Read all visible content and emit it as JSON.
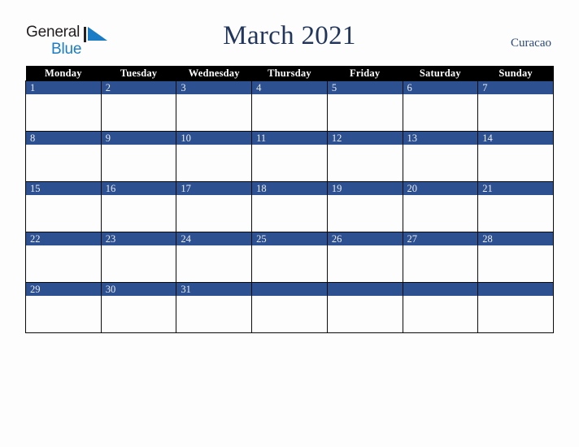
{
  "brand": {
    "name_part1": "General",
    "name_part2": "Blue",
    "mark": "triangle-icon"
  },
  "header": {
    "title": "March 2021",
    "location": "Curacao"
  },
  "calendar": {
    "weekday_headers": [
      "Monday",
      "Tuesday",
      "Wednesday",
      "Thursday",
      "Friday",
      "Saturday",
      "Sunday"
    ],
    "accent_color": "#2d5190",
    "header_color": "#000000",
    "weeks": [
      [
        {
          "date": "1"
        },
        {
          "date": "2"
        },
        {
          "date": "3"
        },
        {
          "date": "4"
        },
        {
          "date": "5"
        },
        {
          "date": "6"
        },
        {
          "date": "7"
        }
      ],
      [
        {
          "date": "8"
        },
        {
          "date": "9"
        },
        {
          "date": "10"
        },
        {
          "date": "11"
        },
        {
          "date": "12"
        },
        {
          "date": "13"
        },
        {
          "date": "14"
        }
      ],
      [
        {
          "date": "15"
        },
        {
          "date": "16"
        },
        {
          "date": "17"
        },
        {
          "date": "18"
        },
        {
          "date": "19"
        },
        {
          "date": "20"
        },
        {
          "date": "21"
        }
      ],
      [
        {
          "date": "22"
        },
        {
          "date": "23"
        },
        {
          "date": "24"
        },
        {
          "date": "25"
        },
        {
          "date": "26"
        },
        {
          "date": "27"
        },
        {
          "date": "28"
        }
      ],
      [
        {
          "date": "29"
        },
        {
          "date": "30"
        },
        {
          "date": "31"
        },
        {
          "date": ""
        },
        {
          "date": ""
        },
        {
          "date": ""
        },
        {
          "date": ""
        }
      ]
    ]
  }
}
